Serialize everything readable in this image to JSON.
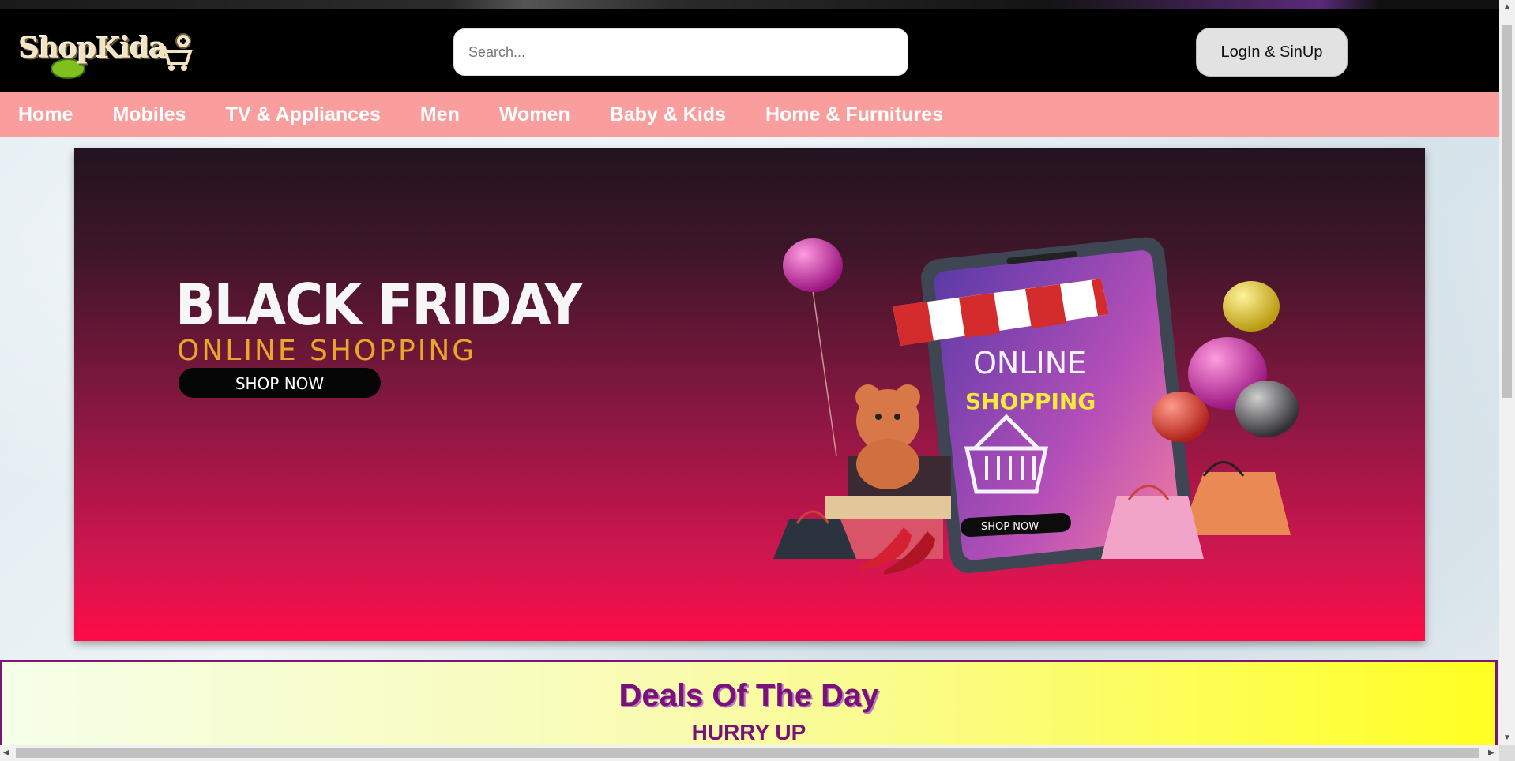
{
  "header": {
    "logo_text": "ShopKida",
    "search": {
      "placeholder": "Search...",
      "value": ""
    },
    "login_label": "LogIn & SinUp"
  },
  "nav": {
    "items": [
      {
        "label": "Home"
      },
      {
        "label": "Mobiles"
      },
      {
        "label": "TV & Appliances"
      },
      {
        "label": "Men"
      },
      {
        "label": "Women"
      },
      {
        "label": "Baby & Kids"
      },
      {
        "label": "Home & Furnitures"
      }
    ]
  },
  "banner": {
    "title": "BLACK FRIDAY",
    "subtitle": "ONLINE SHOPPING",
    "cta": "SHOP NOW",
    "phone_line1": "ONLINE",
    "phone_line2": "SHOPPING",
    "phone_cta": "SHOP NOW"
  },
  "deals": {
    "title": "Deals Of The Day",
    "subtitle": "HURRY UP"
  },
  "colors": {
    "nav_bg": "#fa9d9d",
    "header_bg": "#000000",
    "deals_text": "#7a117a",
    "deals_border": "#7e1474"
  }
}
